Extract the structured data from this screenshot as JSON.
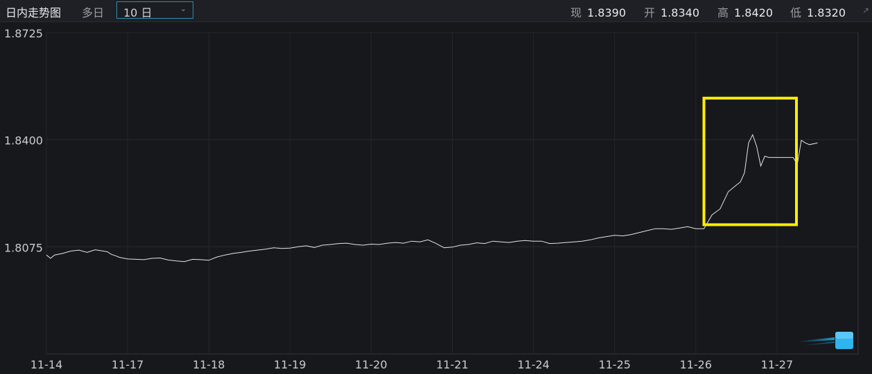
{
  "header": {
    "title": "日内走势图",
    "tab_multi_day": "多日",
    "range_selected": "10 日",
    "quotes": [
      {
        "label": "现",
        "value": "1.8390"
      },
      {
        "label": "开",
        "value": "1.8340"
      },
      {
        "label": "高",
        "value": "1.8420"
      },
      {
        "label": "低",
        "value": "1.8320"
      }
    ]
  },
  "chart_data": {
    "type": "line",
    "title": "",
    "xlabel": "",
    "ylabel": "",
    "ylim": [
      1.775,
      1.8725
    ],
    "yticks": [
      1.8725,
      1.84,
      1.8075
    ],
    "ytick_labels": [
      "1.8725",
      "1.8400",
      "1.8075"
    ],
    "categories": [
      "11-14",
      "11-17",
      "11-18",
      "11-19",
      "11-20",
      "11-21",
      "11-24",
      "11-25",
      "11-26",
      "11-27"
    ],
    "x_domain": [
      0,
      10
    ],
    "grid": true,
    "line_color": "#e6e6e6",
    "highlight_color": "#ffee00",
    "highlight_box": {
      "x": [
        8.1,
        9.24
      ],
      "y": [
        1.8142,
        1.8526
      ]
    },
    "series": [
      {
        "x": [
          0.0,
          0.05,
          0.1,
          0.2,
          0.3,
          0.4,
          0.5,
          0.6,
          0.7,
          0.75,
          0.8,
          0.85,
          0.9,
          1.0,
          1.1,
          1.2,
          1.3,
          1.4,
          1.5,
          1.6,
          1.7,
          1.8,
          1.9,
          2.0,
          2.1,
          2.2,
          2.3,
          2.4,
          2.5,
          2.6,
          2.7,
          2.8,
          2.9,
          3.0,
          3.1,
          3.2,
          3.3,
          3.4,
          3.5,
          3.6,
          3.7,
          3.8,
          3.9,
          4.0,
          4.1,
          4.2,
          4.3,
          4.4,
          4.5,
          4.6,
          4.7,
          4.8,
          4.9,
          5.0,
          5.1,
          5.2,
          5.3,
          5.4,
          5.5,
          5.6,
          5.7,
          5.8,
          5.9,
          6.0,
          6.1,
          6.2,
          6.3,
          6.4,
          6.5,
          6.6,
          6.7,
          6.8,
          6.9,
          7.0,
          7.1,
          7.2,
          7.3,
          7.4,
          7.5,
          7.6,
          7.7,
          7.8,
          7.9,
          8.0,
          8.1,
          8.2,
          8.3,
          8.4,
          8.5,
          8.55,
          8.6,
          8.65,
          8.7,
          8.75,
          8.8,
          8.85,
          8.9,
          9.0,
          9.1,
          9.2,
          9.25,
          9.3,
          9.35,
          9.4,
          9.5
        ],
        "values": [
          1.805,
          1.804,
          1.805,
          1.8055,
          1.8062,
          1.8065,
          1.8058,
          1.8066,
          1.8062,
          1.806,
          1.8052,
          1.8048,
          1.8043,
          1.8038,
          1.8037,
          1.8036,
          1.804,
          1.8041,
          1.8035,
          1.8032,
          1.803,
          1.8037,
          1.8036,
          1.8034,
          1.8044,
          1.805,
          1.8055,
          1.8058,
          1.8062,
          1.8065,
          1.8068,
          1.8072,
          1.807,
          1.8071,
          1.8075,
          1.8078,
          1.8073,
          1.808,
          1.8082,
          1.8085,
          1.8086,
          1.8082,
          1.808,
          1.8083,
          1.8082,
          1.8086,
          1.8088,
          1.8086,
          1.8092,
          1.809,
          1.8096,
          1.8085,
          1.8072,
          1.8074,
          1.808,
          1.8082,
          1.8087,
          1.8085,
          1.8092,
          1.809,
          1.8088,
          1.8092,
          1.8094,
          1.8092,
          1.8092,
          1.8085,
          1.8086,
          1.8088,
          1.809,
          1.8092,
          1.8096,
          1.8102,
          1.8106,
          1.811,
          1.8108,
          1.8112,
          1.8118,
          1.8124,
          1.813,
          1.813,
          1.8128,
          1.8132,
          1.8136,
          1.813,
          1.813,
          1.8172,
          1.819,
          1.8242,
          1.8262,
          1.8272,
          1.83,
          1.839,
          1.8415,
          1.838,
          1.832,
          1.835,
          1.8346,
          1.8346,
          1.8346,
          1.8346,
          1.8325,
          1.8398,
          1.839,
          1.8385,
          1.839
        ]
      }
    ]
  }
}
